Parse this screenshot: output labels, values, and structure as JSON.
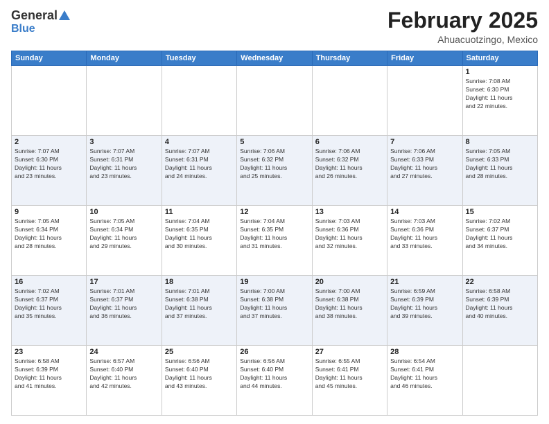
{
  "logo": {
    "general": "General",
    "blue": "Blue"
  },
  "header": {
    "month": "February 2025",
    "location": "Ahuacuotzingo, Mexico"
  },
  "weekdays": [
    "Sunday",
    "Monday",
    "Tuesday",
    "Wednesday",
    "Thursday",
    "Friday",
    "Saturday"
  ],
  "weeks": [
    [
      {
        "day": "",
        "info": ""
      },
      {
        "day": "",
        "info": ""
      },
      {
        "day": "",
        "info": ""
      },
      {
        "day": "",
        "info": ""
      },
      {
        "day": "",
        "info": ""
      },
      {
        "day": "",
        "info": ""
      },
      {
        "day": "1",
        "info": "Sunrise: 7:08 AM\nSunset: 6:30 PM\nDaylight: 11 hours\nand 22 minutes."
      }
    ],
    [
      {
        "day": "2",
        "info": "Sunrise: 7:07 AM\nSunset: 6:30 PM\nDaylight: 11 hours\nand 23 minutes."
      },
      {
        "day": "3",
        "info": "Sunrise: 7:07 AM\nSunset: 6:31 PM\nDaylight: 11 hours\nand 23 minutes."
      },
      {
        "day": "4",
        "info": "Sunrise: 7:07 AM\nSunset: 6:31 PM\nDaylight: 11 hours\nand 24 minutes."
      },
      {
        "day": "5",
        "info": "Sunrise: 7:06 AM\nSunset: 6:32 PM\nDaylight: 11 hours\nand 25 minutes."
      },
      {
        "day": "6",
        "info": "Sunrise: 7:06 AM\nSunset: 6:32 PM\nDaylight: 11 hours\nand 26 minutes."
      },
      {
        "day": "7",
        "info": "Sunrise: 7:06 AM\nSunset: 6:33 PM\nDaylight: 11 hours\nand 27 minutes."
      },
      {
        "day": "8",
        "info": "Sunrise: 7:05 AM\nSunset: 6:33 PM\nDaylight: 11 hours\nand 28 minutes."
      }
    ],
    [
      {
        "day": "9",
        "info": "Sunrise: 7:05 AM\nSunset: 6:34 PM\nDaylight: 11 hours\nand 28 minutes."
      },
      {
        "day": "10",
        "info": "Sunrise: 7:05 AM\nSunset: 6:34 PM\nDaylight: 11 hours\nand 29 minutes."
      },
      {
        "day": "11",
        "info": "Sunrise: 7:04 AM\nSunset: 6:35 PM\nDaylight: 11 hours\nand 30 minutes."
      },
      {
        "day": "12",
        "info": "Sunrise: 7:04 AM\nSunset: 6:35 PM\nDaylight: 11 hours\nand 31 minutes."
      },
      {
        "day": "13",
        "info": "Sunrise: 7:03 AM\nSunset: 6:36 PM\nDaylight: 11 hours\nand 32 minutes."
      },
      {
        "day": "14",
        "info": "Sunrise: 7:03 AM\nSunset: 6:36 PM\nDaylight: 11 hours\nand 33 minutes."
      },
      {
        "day": "15",
        "info": "Sunrise: 7:02 AM\nSunset: 6:37 PM\nDaylight: 11 hours\nand 34 minutes."
      }
    ],
    [
      {
        "day": "16",
        "info": "Sunrise: 7:02 AM\nSunset: 6:37 PM\nDaylight: 11 hours\nand 35 minutes."
      },
      {
        "day": "17",
        "info": "Sunrise: 7:01 AM\nSunset: 6:37 PM\nDaylight: 11 hours\nand 36 minutes."
      },
      {
        "day": "18",
        "info": "Sunrise: 7:01 AM\nSunset: 6:38 PM\nDaylight: 11 hours\nand 37 minutes."
      },
      {
        "day": "19",
        "info": "Sunrise: 7:00 AM\nSunset: 6:38 PM\nDaylight: 11 hours\nand 37 minutes."
      },
      {
        "day": "20",
        "info": "Sunrise: 7:00 AM\nSunset: 6:38 PM\nDaylight: 11 hours\nand 38 minutes."
      },
      {
        "day": "21",
        "info": "Sunrise: 6:59 AM\nSunset: 6:39 PM\nDaylight: 11 hours\nand 39 minutes."
      },
      {
        "day": "22",
        "info": "Sunrise: 6:58 AM\nSunset: 6:39 PM\nDaylight: 11 hours\nand 40 minutes."
      }
    ],
    [
      {
        "day": "23",
        "info": "Sunrise: 6:58 AM\nSunset: 6:39 PM\nDaylight: 11 hours\nand 41 minutes."
      },
      {
        "day": "24",
        "info": "Sunrise: 6:57 AM\nSunset: 6:40 PM\nDaylight: 11 hours\nand 42 minutes."
      },
      {
        "day": "25",
        "info": "Sunrise: 6:56 AM\nSunset: 6:40 PM\nDaylight: 11 hours\nand 43 minutes."
      },
      {
        "day": "26",
        "info": "Sunrise: 6:56 AM\nSunset: 6:40 PM\nDaylight: 11 hours\nand 44 minutes."
      },
      {
        "day": "27",
        "info": "Sunrise: 6:55 AM\nSunset: 6:41 PM\nDaylight: 11 hours\nand 45 minutes."
      },
      {
        "day": "28",
        "info": "Sunrise: 6:54 AM\nSunset: 6:41 PM\nDaylight: 11 hours\nand 46 minutes."
      },
      {
        "day": "",
        "info": ""
      }
    ]
  ]
}
